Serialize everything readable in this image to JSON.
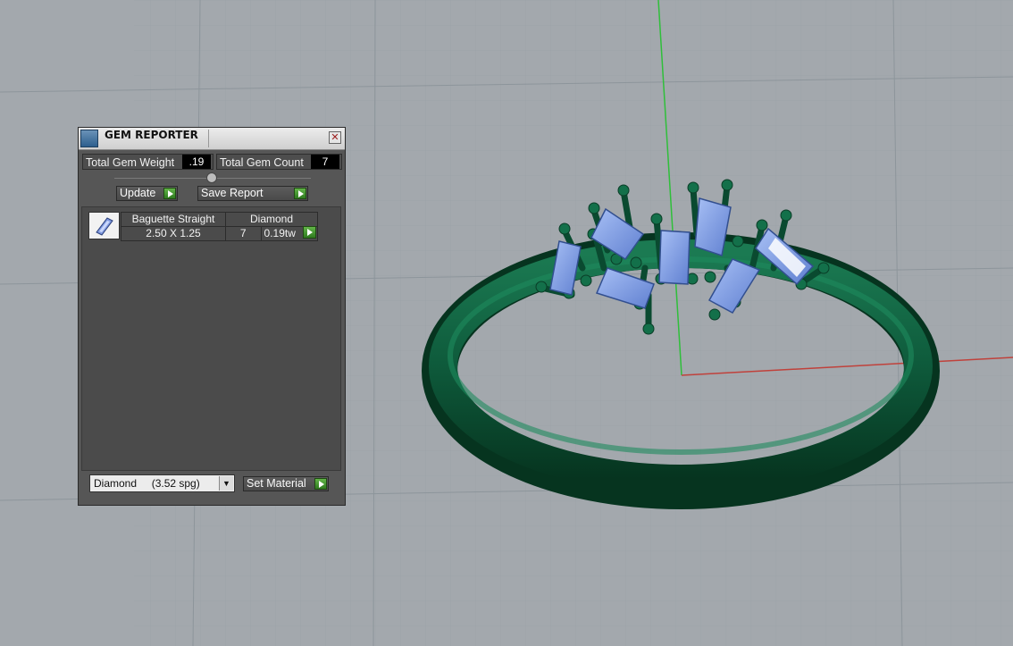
{
  "panel": {
    "title": "GEM REPORTER",
    "total_weight_label": "Total Gem Weight",
    "total_weight_value": ".19",
    "total_count_label": "Total Gem Count",
    "total_count_value": "7",
    "update_label": "Update",
    "save_report_label": "Save Report",
    "gems": [
      {
        "shape": "Baguette Straight",
        "material": "Diamond",
        "size": "2.50 X 1.25",
        "count": "7",
        "weight": "0.19tw"
      }
    ],
    "material_select": "Diamond     (3.52 spg)",
    "set_material_label": "Set Material"
  },
  "colors": {
    "viewport_bg": "#a3a8ad",
    "ring_metal": "#0f5a3c",
    "gem_blue": "#7fa0e6",
    "axis_green": "#2fbf3a",
    "axis_red": "#c0413b"
  }
}
